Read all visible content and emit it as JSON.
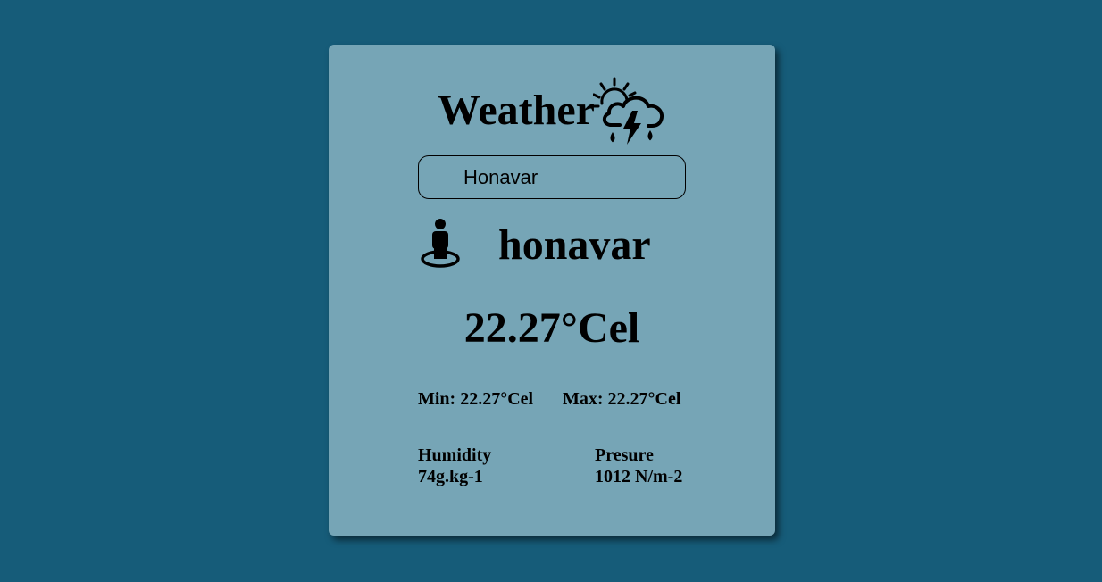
{
  "colors": {
    "background": "#165c79",
    "card": "#76a5b6",
    "text": "#000000"
  },
  "header": {
    "title": "Weather",
    "icon": "sun-cloud-thunder-rain-icon"
  },
  "search": {
    "value": "Honavar"
  },
  "location": {
    "icon": "person-location-icon",
    "city": "honavar"
  },
  "temperature": {
    "current": "22.27°Cel",
    "min": "Min: 22.27°Cel",
    "max": "Max: 22.27°Cel"
  },
  "stats": {
    "humidity_label": "Humidity",
    "humidity_value": "74g.kg-1",
    "pressure_label": "Presure",
    "pressure_value": "1012 N/m-2"
  }
}
